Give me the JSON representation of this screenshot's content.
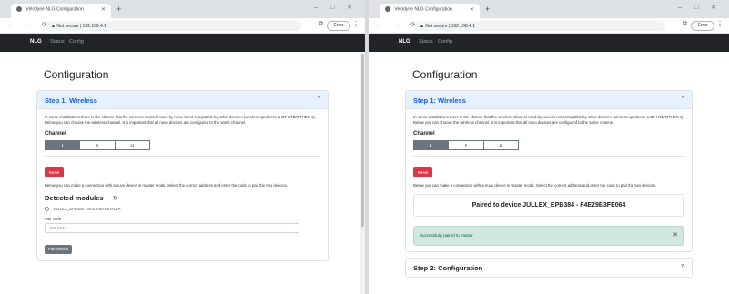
{
  "browser": {
    "tab_title": "Velodyne NLG Configuration",
    "new_tab": "+",
    "window_controls": "– □ ✕",
    "nav_buttons": "← → ⟳",
    "url": "▲ Not secure | 192.168.4.1",
    "extension_icon": "puzzle-icon",
    "profile_label": "Error",
    "menu": "⋮"
  },
  "navbar": {
    "brand": "NLG",
    "links": [
      "Status",
      "Config"
    ]
  },
  "page": {
    "title": "Configuration"
  },
  "step1": {
    "title": "Step 1: Wireless",
    "chevron": "^",
    "intro": "In some installations there is the chance that the wireless channel used by nuvo is not compatible by other devices (wireless speakers, a BT HTB/OTHER s). Below you can choose the wireless channel. It is important that all nuvo devices are configured to the same channel.",
    "channel_label": "Channel",
    "channels": [
      "1",
      "6",
      "11"
    ],
    "reset_label": "Reset",
    "connect_text": "Below you can make a connection with a nuvo device in master mode. Select the correct address and enter the code to pair the two devices."
  },
  "left": {
    "detected_title": "Detected modules",
    "refresh_glyph": "↻",
    "module_option": "JULLEX_EPB384 - 94:E9:B9:E9:84:1A",
    "pin_label": "Pair code",
    "pin_placeholder": "123-0217",
    "pair_button": "Pair device"
  },
  "right": {
    "paired_text": "Paired to device JULLEX_EPB384 - F4E29B3FE064",
    "alert_text": "Successfully paired to master",
    "alert_close": "✕",
    "step2_title": "Step 2: Configuration",
    "step2_chevron": "v"
  },
  "colors": {
    "accent": "#0c63e4",
    "danger": "#dc3545",
    "success_bg": "#d1e7dd",
    "navbar": "#212529"
  }
}
